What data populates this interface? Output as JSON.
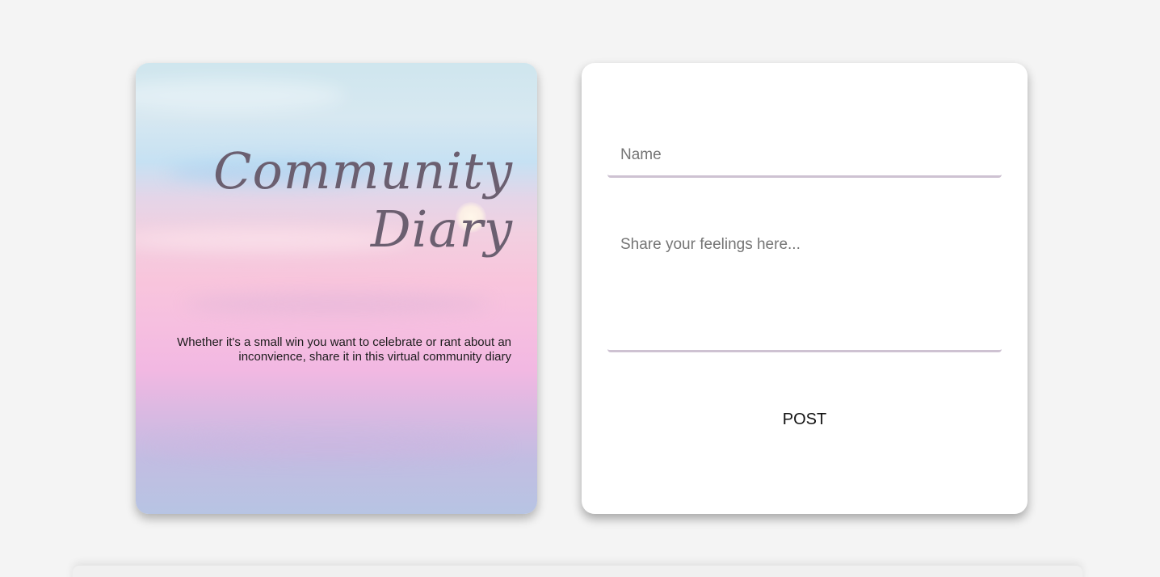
{
  "hero": {
    "title_line1": "Community",
    "title_line2": "Diary",
    "description": "Whether it's a small win you want to celebrate or rant about an inconvience, share it in this virtual community diary"
  },
  "form": {
    "name_placeholder": "Name",
    "name_value": "",
    "feelings_placeholder": "Share your feelings here...",
    "feelings_value": "",
    "post_label": "POST"
  },
  "colors": {
    "page_background": "#f4f4f4",
    "card_background": "#ffffff",
    "title_color": "#6b5f70",
    "input_underline": "#cec2d2"
  }
}
